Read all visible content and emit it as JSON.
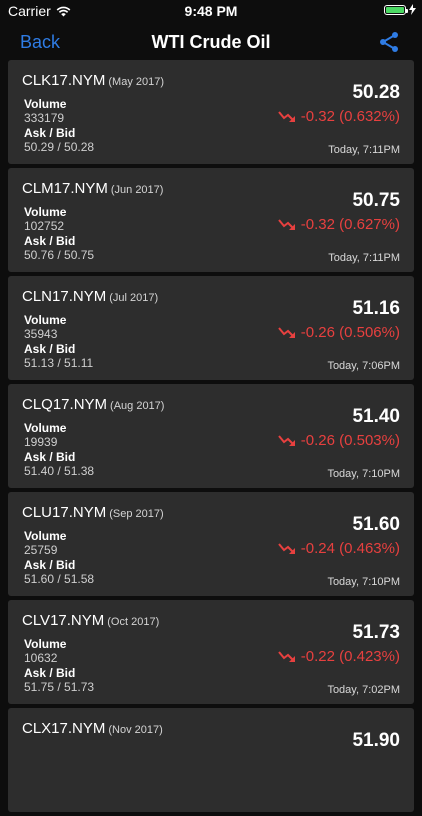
{
  "status": {
    "carrier": "Carrier",
    "time": "9:48 PM"
  },
  "nav": {
    "back": "Back",
    "title": "WTI Crude Oil"
  },
  "colors": {
    "accent": "#2f7ce4",
    "negative": "#e7403f",
    "card": "#2d2d2d",
    "battery": "#4cd964"
  },
  "icons": {
    "back": "back-text",
    "share": "share-icon",
    "change": "trend-down-arrow-icon",
    "wifi": "wifi-icon",
    "battery": "battery-icon"
  },
  "labels": {
    "volume": "Volume",
    "ask_bid": "Ask / Bid"
  },
  "quotes": [
    {
      "symbol": "CLK17.NYM",
      "month": "(May 2017)",
      "volume": "333179",
      "ask_bid": "50.29 / 50.28",
      "price": "50.28",
      "change": "-0.32 (0.632%)",
      "time": "Today, 7:11PM"
    },
    {
      "symbol": "CLM17.NYM",
      "month": "(Jun 2017)",
      "volume": "102752",
      "ask_bid": "50.76 / 50.75",
      "price": "50.75",
      "change": "-0.32 (0.627%)",
      "time": "Today, 7:11PM"
    },
    {
      "symbol": "CLN17.NYM",
      "month": "(Jul 2017)",
      "volume": "35943",
      "ask_bid": "51.13 / 51.11",
      "price": "51.16",
      "change": "-0.26 (0.506%)",
      "time": "Today, 7:06PM"
    },
    {
      "symbol": "CLQ17.NYM",
      "month": "(Aug 2017)",
      "volume": "19939",
      "ask_bid": "51.40 / 51.38",
      "price": "51.40",
      "change": "-0.26 (0.503%)",
      "time": "Today, 7:10PM"
    },
    {
      "symbol": "CLU17.NYM",
      "month": "(Sep 2017)",
      "volume": "25759",
      "ask_bid": "51.60 / 51.58",
      "price": "51.60",
      "change": "-0.24 (0.463%)",
      "time": "Today, 7:10PM"
    },
    {
      "symbol": "CLV17.NYM",
      "month": "(Oct 2017)",
      "volume": "10632",
      "ask_bid": "51.75 / 51.73",
      "price": "51.73",
      "change": "-0.22 (0.423%)",
      "time": "Today, 7:02PM"
    },
    {
      "symbol": "CLX17.NYM",
      "month": "(Nov 2017)",
      "volume": "",
      "ask_bid": "",
      "price": "51.90",
      "change": "",
      "time": ""
    }
  ]
}
